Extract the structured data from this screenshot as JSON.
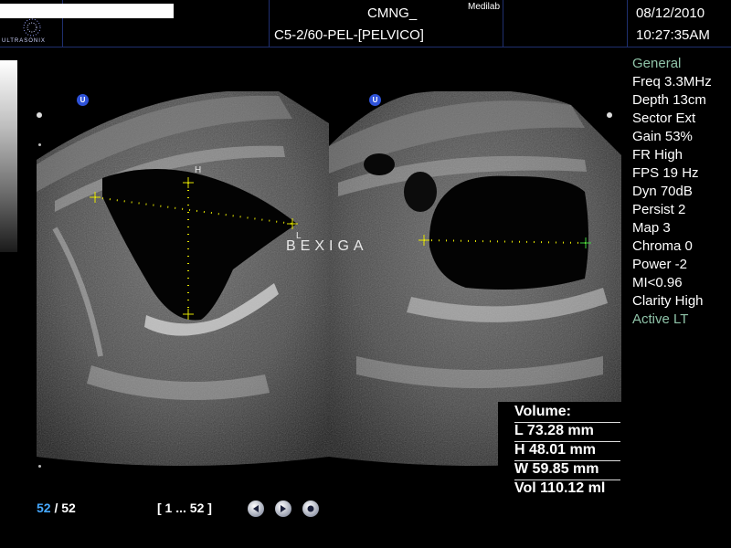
{
  "header": {
    "logo_text": "ULTRASONIX",
    "institution": "CMNG_",
    "probe_preset": "C5-2/60-PEL-[PELVICO]",
    "vendor": "Medilab",
    "date": "08/12/2010",
    "time": "10:27:35AM"
  },
  "image": {
    "label": "BEXIGA",
    "caliper_h_tag": "H",
    "caliper_l_tag": "L",
    "left_marker": "U",
    "right_marker": "U"
  },
  "params": [
    {
      "text": "General",
      "accent": true
    },
    {
      "text": "Freq 3.3MHz",
      "accent": false
    },
    {
      "text": "Depth 13cm",
      "accent": false
    },
    {
      "text": "Sector Ext",
      "accent": false
    },
    {
      "text": "Gain 53%",
      "accent": false
    },
    {
      "text": "FR High",
      "accent": false
    },
    {
      "text": "FPS 19 Hz",
      "accent": false
    },
    {
      "text": "Dyn 70dB",
      "accent": false
    },
    {
      "text": "Persist 2",
      "accent": false
    },
    {
      "text": "Map 3",
      "accent": false
    },
    {
      "text": "Chroma 0",
      "accent": false
    },
    {
      "text": "Power -2",
      "accent": false
    },
    {
      "text": "MI<0.96",
      "accent": false
    },
    {
      "text": "Clarity High",
      "accent": false
    },
    {
      "text": "Active LT",
      "accent": true
    }
  ],
  "measurements": {
    "title": "Volume:",
    "length": "L 73.28 mm",
    "height": "H 48.01 mm",
    "width": "W 59.85 mm",
    "volume": "Vol 110.12 ml"
  },
  "footer": {
    "current_frame": "52",
    "separator": " / ",
    "total_frames": "52",
    "frame_range": "[ 1 ... 52 ]"
  },
  "icons": {
    "rewind": "rewind-icon",
    "play": "play-icon",
    "stop": "stop-icon"
  },
  "colors": {
    "accent_text": "#8fc3a8",
    "frame_current": "#46a9ff",
    "marker_blue": "#2e52d8",
    "caliper": "#e6e600",
    "caliper_green": "#3fd13f"
  }
}
